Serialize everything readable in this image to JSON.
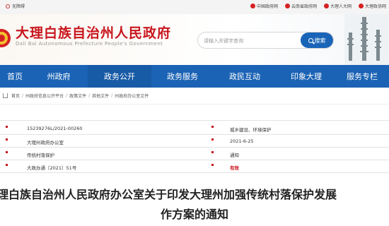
{
  "topbar": {
    "accessibility": "无障碍",
    "links": [
      "中国政府网",
      "云南省政府网",
      "大理人大网",
      "大理政协网"
    ]
  },
  "header": {
    "title": "大理白族自治州人民政府",
    "subtitle": "Dali Bai Autonomous Prefecture People's Government"
  },
  "search": {
    "placeholder": "请输入关键字查询",
    "button": "搜索"
  },
  "nav": {
    "items": [
      "首页",
      "州政府",
      "政务公开",
      "政务服务",
      "政民互动",
      "印象大理",
      "服务专栏"
    ]
  },
  "breadcrumb": [
    "首页",
    "州政府信息公开平台",
    "政策文件",
    "其他文件",
    "州政府办公室文件"
  ],
  "info": {
    "index_no": "15239276L/2021-00260",
    "category": "城乡建设、环境保护",
    "publisher": "大理州政府办公室",
    "date": "2021-6-25",
    "title": "传统村落保护",
    "doc_type": "通知",
    "doc_no": "大政办通〔2021〕51号",
    "validity": "有效"
  },
  "article": {
    "title_line1": "理白族自治州人民政府办公室关于印发大理州加强传统村落保护发展",
    "title_line2": "作方案的通知"
  },
  "colors": {
    "brand_red": "#c8161d",
    "nav_blue": "#1b63b5"
  }
}
